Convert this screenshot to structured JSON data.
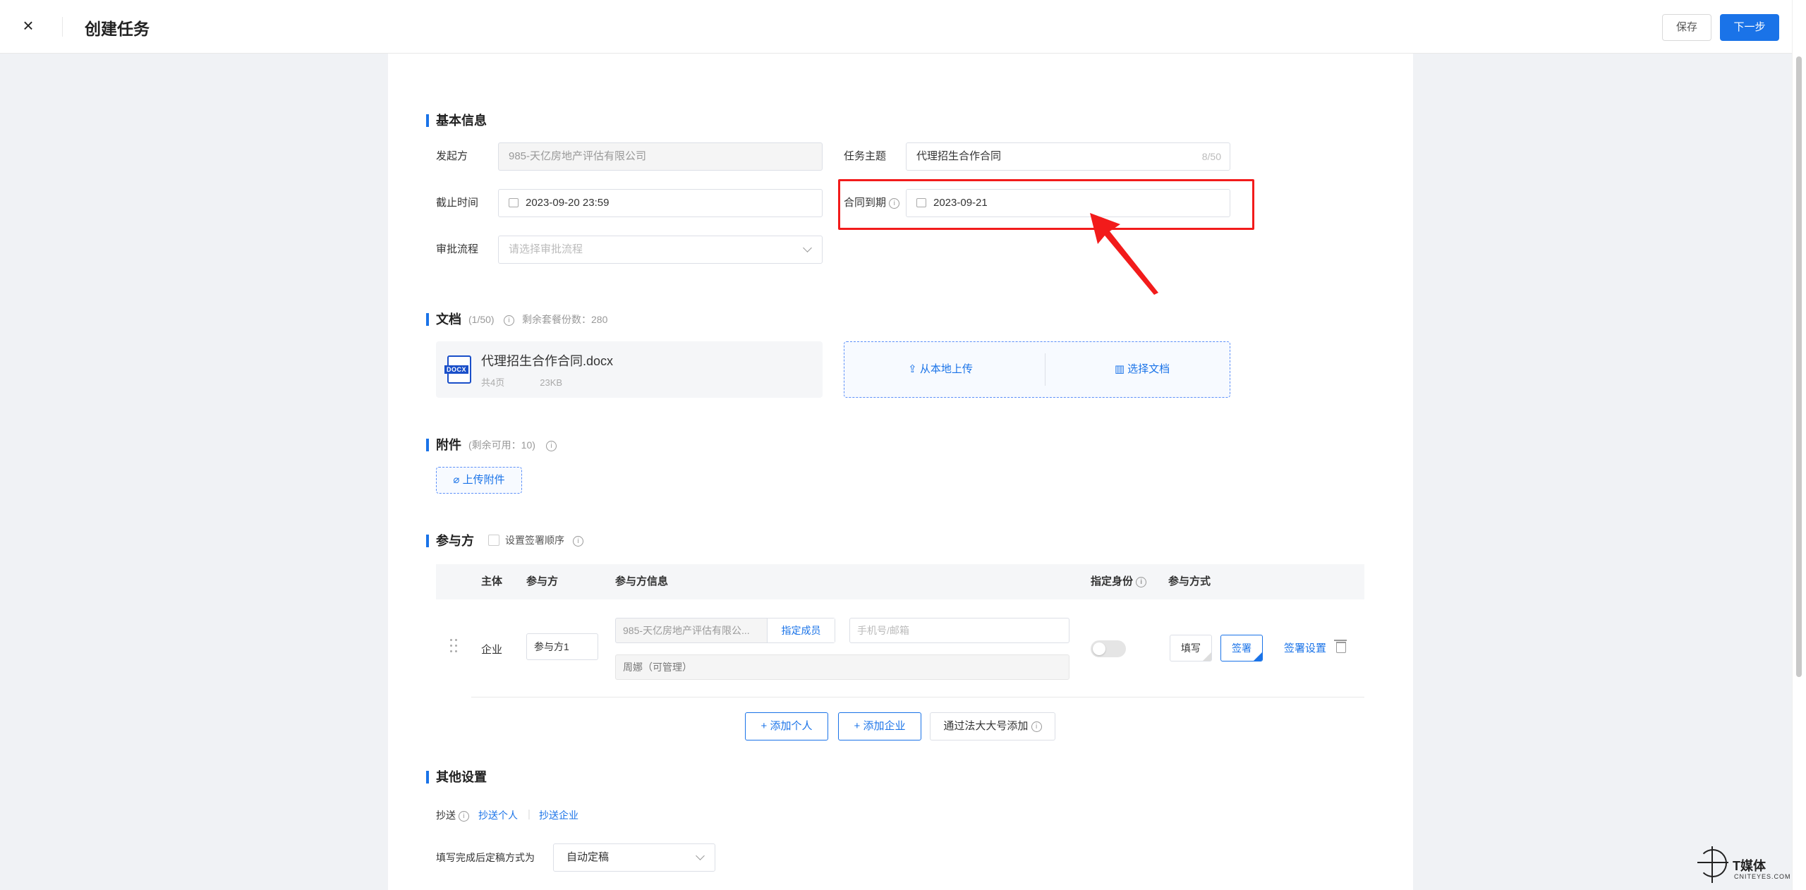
{
  "header": {
    "title": "创建任务",
    "save_label": "保存",
    "next_label": "下一步"
  },
  "basic": {
    "section_title": "基本信息",
    "initiator_label": "发起方",
    "initiator_value": "985-天亿房地产评估有限公司",
    "subject_label": "任务主题",
    "subject_value": "代理招生合作合同",
    "subject_count": "8/50",
    "deadline_label": "截止时间",
    "deadline_value": "2023-09-20 23:59",
    "expiry_label": "合同到期",
    "expiry_value": "2023-09-21",
    "approval_label": "审批流程",
    "approval_placeholder": "请选择审批流程"
  },
  "documents": {
    "section_title": "文档",
    "count_note": "(1/50)",
    "remaining_note": "剩余套餐份数：280",
    "file_name": "代理招生合作合同.docx",
    "file_badge": "DOCX",
    "file_pages": "共4页",
    "file_size": "23KB",
    "upload_local": "从本地上传",
    "choose_doc": "选择文档"
  },
  "attachments": {
    "section_title": "附件",
    "remaining_note": "(剩余可用：10)",
    "upload_label": "上传附件"
  },
  "participants": {
    "section_title": "参与方",
    "order_label": "设置签署顺序",
    "columns": [
      "主体",
      "参与方",
      "参与方信息",
      "指定身份",
      "参与方式"
    ],
    "row": {
      "entity": "企业",
      "party_name": "参与方1",
      "org_name": "985-天亿房地产评估有限公...",
      "assign_member": "指定成员",
      "contact_placeholder": "手机号/邮箱",
      "member": "周娜（可管理）",
      "mode_fill": "填写",
      "mode_sign": "签署",
      "sign_settings": "签署设置"
    },
    "add_person": "+ 添加个人",
    "add_company": "+ 添加企业",
    "add_via_account": "通过法大大号添加"
  },
  "other": {
    "section_title": "其他设置",
    "cc_label": "抄送",
    "cc_person": "抄送个人",
    "cc_company": "抄送企业",
    "finalize_label": "填写完成后定稿方式为",
    "finalize_value": "自动定稿"
  },
  "watermark": {
    "brand": "T媒体",
    "sub": "CNITEYES.COM"
  },
  "colors": {
    "primary": "#1a73e8",
    "annotation": "#f21b1b"
  }
}
